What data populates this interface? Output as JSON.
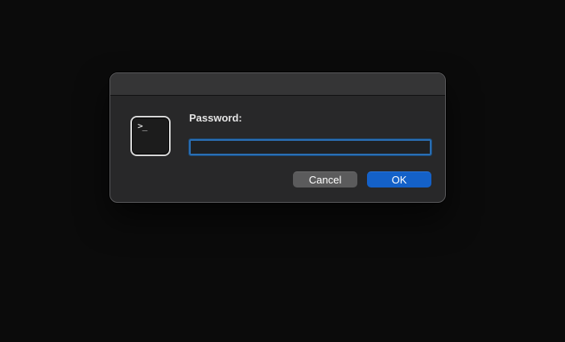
{
  "dialog": {
    "app_icon": "terminal-icon",
    "icon_glyph": ">_",
    "label": "Password:",
    "password_value": "",
    "buttons": {
      "cancel": "Cancel",
      "ok": "OK"
    }
  },
  "colors": {
    "accent": "#1461c8",
    "focus_ring": "#2a6fb4",
    "dialog_bg": "#282829",
    "desktop_bg": "#0b0b0b"
  }
}
